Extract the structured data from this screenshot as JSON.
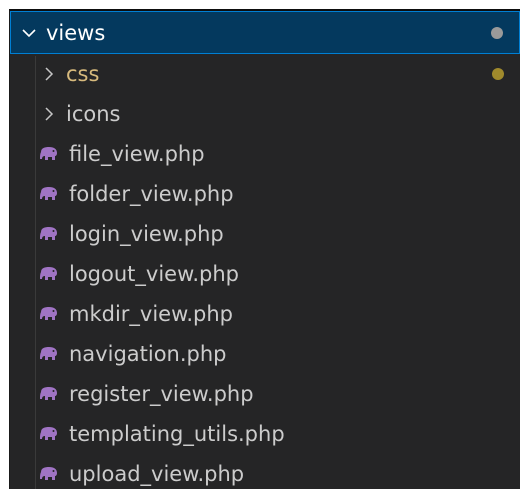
{
  "explorer": {
    "folder": {
      "label": "views",
      "icon": "chevron-down-icon",
      "badge_color": "#9a9a9a"
    },
    "items": [
      {
        "label": "css",
        "kind": "folder",
        "icon": "chevron-right-icon",
        "status": "modified",
        "badge_color": "#a08a2c"
      },
      {
        "label": "icons",
        "kind": "folder",
        "icon": "chevron-right-icon"
      },
      {
        "label": "file_view.php",
        "kind": "file",
        "icon": "php-elephant-icon"
      },
      {
        "label": "folder_view.php",
        "kind": "file",
        "icon": "php-elephant-icon"
      },
      {
        "label": "login_view.php",
        "kind": "file",
        "icon": "php-elephant-icon"
      },
      {
        "label": "logout_view.php",
        "kind": "file",
        "icon": "php-elephant-icon"
      },
      {
        "label": "mkdir_view.php",
        "kind": "file",
        "icon": "php-elephant-icon"
      },
      {
        "label": "navigation.php",
        "kind": "file",
        "icon": "php-elephant-icon"
      },
      {
        "label": "register_view.php",
        "kind": "file",
        "icon": "php-elephant-icon"
      },
      {
        "label": "templating_utils.php",
        "kind": "file",
        "icon": "php-elephant-icon"
      },
      {
        "label": "upload_view.php",
        "kind": "file",
        "icon": "php-elephant-icon"
      }
    ]
  },
  "colors": {
    "panel_bg": "#252526",
    "selected_bg": "#04395e",
    "selected_border": "#007fd4",
    "text": "#cccccc",
    "modified_text": "#d7ba7d",
    "php_icon": "#a074c4"
  }
}
